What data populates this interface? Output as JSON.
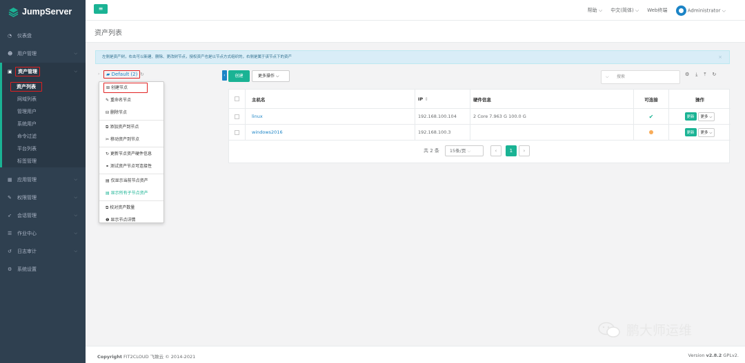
{
  "app": {
    "logo_text": "JumpServer"
  },
  "sidebar": {
    "items": [
      {
        "label": "仪表盘",
        "icon": "dashboard-icon"
      },
      {
        "label": "用户管理",
        "icon": "users-icon"
      },
      {
        "label": "资产管理",
        "icon": "inbox-icon"
      },
      {
        "label": "应用管理",
        "icon": "grid-icon"
      },
      {
        "label": "权限管理",
        "icon": "edit-icon"
      },
      {
        "label": "会话管理",
        "icon": "rocket-icon"
      },
      {
        "label": "作业中心",
        "icon": "list-icon"
      },
      {
        "label": "日志审计",
        "icon": "history-icon"
      },
      {
        "label": "系统设置",
        "icon": "gears-icon"
      }
    ],
    "sub_items": [
      "资产列表",
      "网域列表",
      "管理用户",
      "系统用户",
      "命令过滤",
      "平台列表",
      "标签管理"
    ]
  },
  "topbar": {
    "help": "帮助",
    "language": "中文(简体)",
    "web_terminal": "Web终端",
    "user": "Administrator"
  },
  "page": {
    "title": "资产列表"
  },
  "info_banner": "左侧是资产树，右击可以新建、删除、更改树节点，授权资产也是以节点方式组织的，右侧是属于该节点下的资产",
  "tree": {
    "root_label": "Default (2)"
  },
  "context_menu": {
    "group1": [
      "创建节点",
      "重命名节点",
      "删除节点"
    ],
    "group2": [
      "添加资产到节点",
      "移动资产到节点"
    ],
    "group3": [
      "更新节点资产硬件信息",
      "测试资产节点可连接性"
    ],
    "group4": [
      "仅显示当前节点资产",
      "显示所有子节点资产"
    ],
    "group5": [
      "校对资产数量",
      "显示节点详情"
    ]
  },
  "toolbar": {
    "create": "创建",
    "more_actions": "更多操作",
    "search_placeholder": "搜索"
  },
  "table": {
    "headers": {
      "hostname": "主机名",
      "ip": "IP",
      "hardware": "硬件信息",
      "connectivity": "可连接",
      "actions": "操作"
    },
    "rows": [
      {
        "hostname": "linux",
        "ip": "192.168.100.104",
        "hardware": "2 Core 7.963 G 100.0 G",
        "connectivity": "ok",
        "update": "更新",
        "more": "更多"
      },
      {
        "hostname": "windows2016",
        "ip": "192.168.100.3",
        "hardware": "",
        "connectivity": "unknown",
        "update": "更新",
        "more": "更多"
      }
    ]
  },
  "pagination": {
    "total": "共 2 条",
    "page_size": "15条/页",
    "current": "1"
  },
  "footer": {
    "copyright_bold": "Copyright",
    "copyright": "FIT2CLOUD 飞致云 © 2014-2021",
    "version_prefix": "Version",
    "version": "v2.8.2",
    "license": "GPLv2."
  },
  "watermark": "鹏大师运维",
  "colors": {
    "sidebar": "#2f4050",
    "accent": "#1ab394",
    "link": "#1c84c6",
    "highlight": "#e02020",
    "warning": "#f8ac59"
  }
}
